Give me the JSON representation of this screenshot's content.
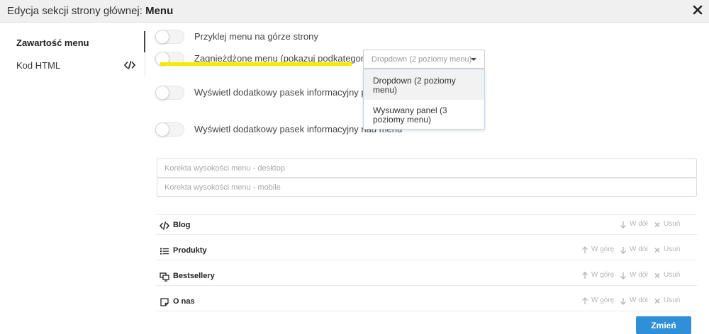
{
  "header": {
    "title_prefix": "Edycja sekcji strony głównej: ",
    "title_section": "Menu"
  },
  "sidebar": {
    "items": [
      {
        "label": "Zawartość menu"
      },
      {
        "label": "Kod HTML"
      }
    ]
  },
  "toggles": [
    {
      "label": "Przyklej menu na górze strony",
      "on": false
    },
    {
      "label": "Zagnieżdżone menu (pokazuj podkategorie)",
      "on": false
    },
    {
      "label": "Wyświetl dodatkowy pasek informacyjny pod menu",
      "on": false
    },
    {
      "label": "Wyświetl dodatkowy pasek informacyjny nad menu",
      "on": false
    }
  ],
  "menu_type": {
    "selected": "Dropdown (2 poziomy menu)",
    "options": [
      {
        "line1": "Dropdown (2 poziomy",
        "line2": "menu)"
      },
      {
        "line1": "Wysuwany panel (3",
        "line2": "poziomy menu)"
      }
    ]
  },
  "height_fields": {
    "desktop_placeholder": "Korekta wysokości menu - desktop",
    "mobile_placeholder": "Korekta wysokości menu - mobile"
  },
  "menu_items": [
    {
      "name": "Blog",
      "icon": "code-icon"
    },
    {
      "name": "Produkty",
      "icon": "list-icon"
    },
    {
      "name": "Bestsellery",
      "icon": "monitors-icon"
    },
    {
      "name": "O nas",
      "icon": "note-icon"
    }
  ],
  "actions": {
    "up": "W górę",
    "down": "W dół",
    "delete": "Usuń"
  },
  "footer": {
    "submit_label": "Zmień"
  },
  "colors": {
    "accent": "#2f8fd8",
    "highlight": "#f5ea00",
    "header_bg": "#f0f0f0"
  }
}
